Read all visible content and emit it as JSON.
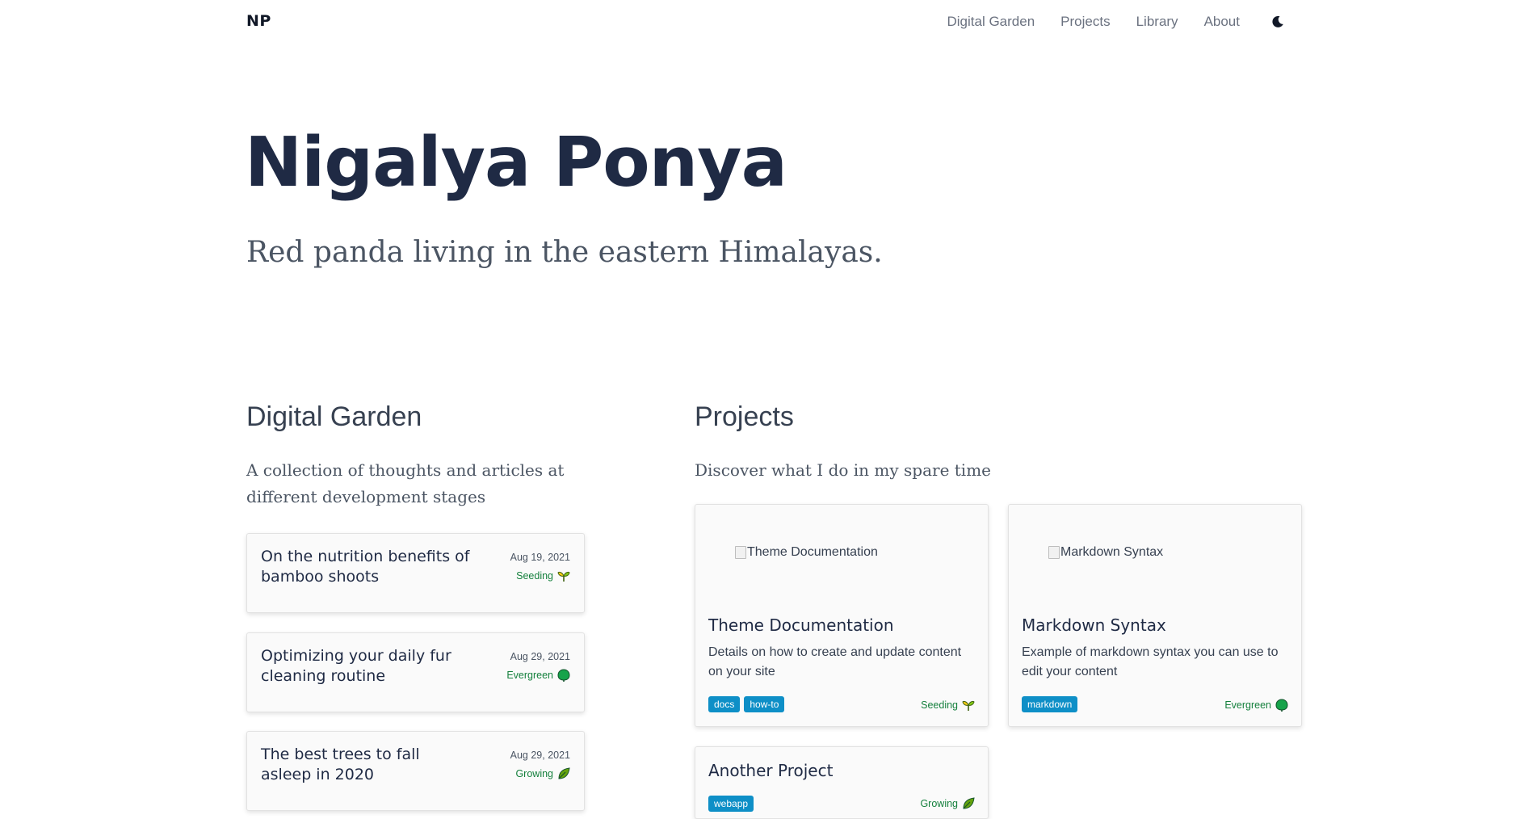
{
  "site": {
    "logo": "NP"
  },
  "nav": {
    "items": [
      "Digital Garden",
      "Projects",
      "Library",
      "About"
    ]
  },
  "hero": {
    "title": "Nigalya Ponya",
    "subtitle": "Red panda living in the eastern Himalayas."
  },
  "garden": {
    "title": "Digital Garden",
    "description": "A collection of thoughts and articles at different development stages",
    "notes": [
      {
        "title": "On the nutrition benefits of bamboo shoots",
        "date": "Aug 19, 2021",
        "stage": "Seeding"
      },
      {
        "title": "Optimizing your daily fur cleaning routine",
        "date": "Aug 29, 2021",
        "stage": "Evergreen"
      },
      {
        "title": "The best trees to fall asleep in 2020",
        "date": "Aug 29, 2021",
        "stage": "Growing"
      }
    ]
  },
  "projects": {
    "title": "Projects",
    "description": "Discover what I do in my spare time",
    "items": [
      {
        "image_alt": "Theme Documentation",
        "title": "Theme Documentation",
        "description": "Details on how to create and update content on your site",
        "tags": [
          "docs",
          "how-to"
        ],
        "stage": "Seeding"
      },
      {
        "image_alt": "Markdown Syntax",
        "title": "Markdown Syntax",
        "description": "Example of markdown syntax you can use to edit your content",
        "tags": [
          "markdown"
        ],
        "stage": "Evergreen"
      },
      {
        "title": "Another Project",
        "tags": [
          "webapp"
        ],
        "stage": "Growing"
      }
    ]
  },
  "colors": {
    "accent": "#0e8fc7",
    "stage": "#15803d",
    "heading": "#1f2a44"
  }
}
